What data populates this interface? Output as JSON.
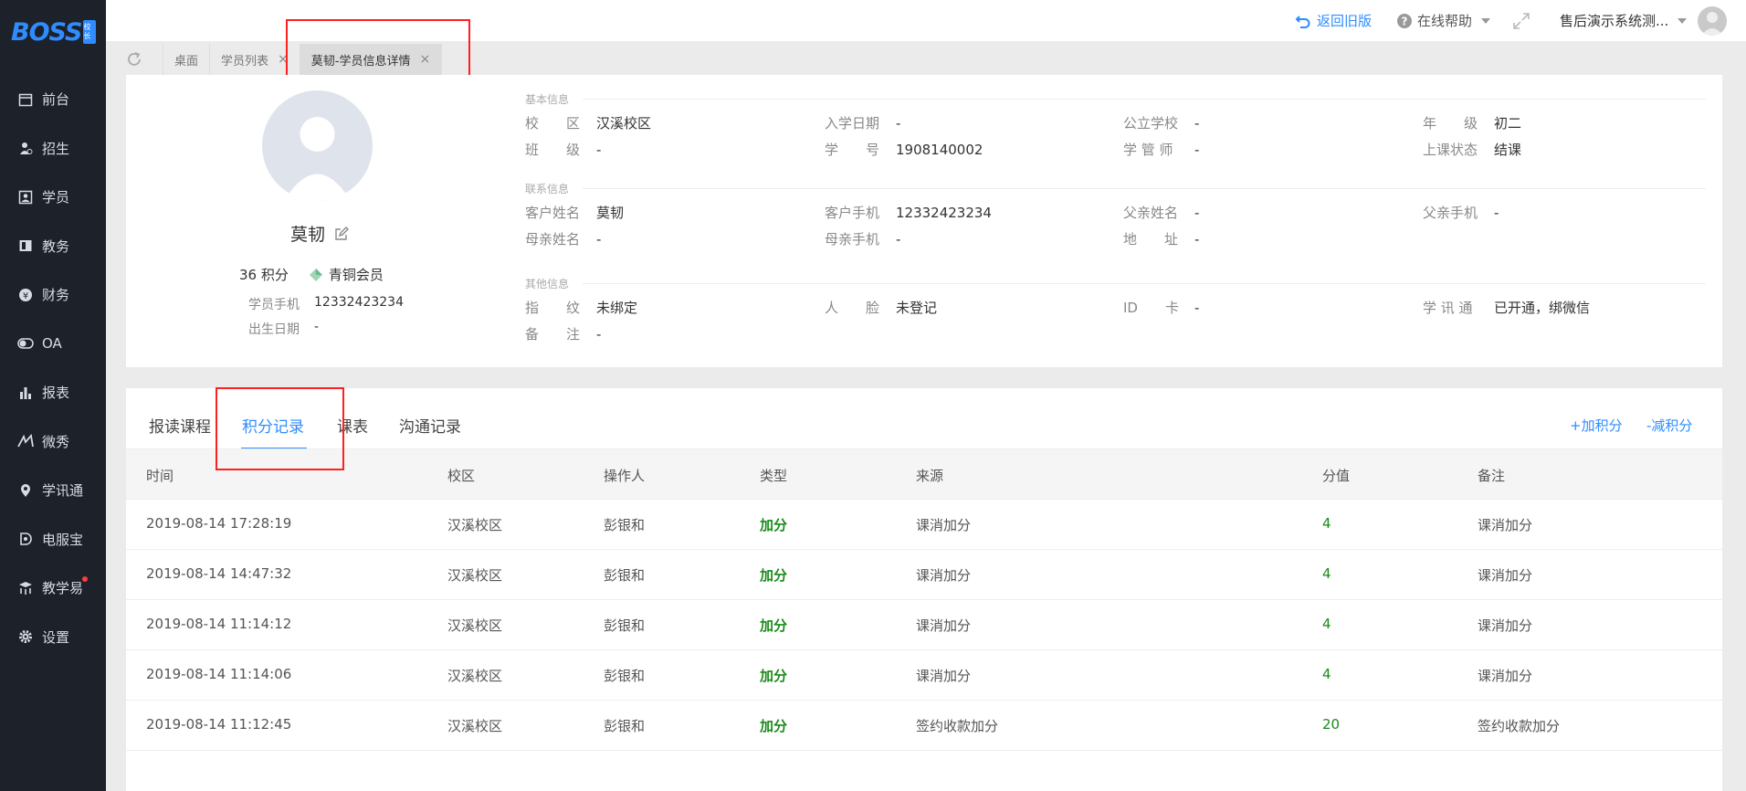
{
  "brand": {
    "logo_text": "BOSS",
    "badge_text": "校长"
  },
  "sidebar": {
    "items": [
      {
        "label": "前台",
        "icon": "calendar-icon"
      },
      {
        "label": "招生",
        "icon": "person-add-icon"
      },
      {
        "label": "学员",
        "icon": "student-card-icon"
      },
      {
        "label": "教务",
        "icon": "book-icon"
      },
      {
        "label": "财务",
        "icon": "yen-icon"
      },
      {
        "label": "OA",
        "icon": "toggle-icon"
      },
      {
        "label": "报表",
        "icon": "bar-chart-icon"
      },
      {
        "label": "微秀",
        "icon": "xiu-icon"
      },
      {
        "label": "学讯通",
        "icon": "location-pin-icon"
      },
      {
        "label": "电服宝",
        "icon": "phone-service-icon"
      },
      {
        "label": "教学易",
        "icon": "teach-icon"
      },
      {
        "label": "设置",
        "icon": "gear-icon"
      }
    ]
  },
  "topbar": {
    "back_old": "返回旧版",
    "help": "在线帮助",
    "account": "售后演示系统测..."
  },
  "tabs": [
    {
      "label": "桌面"
    },
    {
      "label": "学员列表",
      "close": "×"
    },
    {
      "label": "莫韧-学员信息详情",
      "close": "×"
    }
  ],
  "student": {
    "name": "莫韧",
    "points": "36 积分",
    "member_level": "青铜会员",
    "phone_label": "学员手机",
    "phone_value": "12332423234",
    "birth_label": "出生日期",
    "birth_value": "-"
  },
  "sections": {
    "basic": "基本信息",
    "contact": "联系信息",
    "other": "其他信息"
  },
  "basic": {
    "campus_l": "校　　区",
    "campus_v": "汉溪校区",
    "enroll_l": "入学日期",
    "enroll_v": "-",
    "school_l": "公立学校",
    "school_v": "-",
    "grade_l": "年　　级",
    "grade_v": "初二",
    "class_l": "班　　级",
    "class_v": "-",
    "sno_l": "学　　号",
    "sno_v": "1908140002",
    "mgr_l": "学 管 师",
    "mgr_v": "-",
    "status_l": "上课状态",
    "status_v": "结课"
  },
  "contact": {
    "cname_l": "客户姓名",
    "cname_v": "莫韧",
    "cphone_l": "客户手机",
    "cphone_v": "12332423234",
    "fname_l": "父亲姓名",
    "fname_v": "-",
    "fphone_l": "父亲手机",
    "fphone_v": "-",
    "mname_l": "母亲姓名",
    "mname_v": "-",
    "mphone_l": "母亲手机",
    "mphone_v": "-",
    "addr_l": "地　　址",
    "addr_v": "-"
  },
  "other": {
    "finger_l": "指　　纹",
    "finger_v": "未绑定",
    "face_l": "人　　脸",
    "face_v": "未登记",
    "idcard_l": "ID　　卡",
    "idcard_v": "-",
    "xxt_l": "学 讯 通",
    "xxt_opened": "已开通",
    "xxt_sep": "，",
    "xxt_bind": "绑微信",
    "remark_l": "备　　注",
    "remark_v": "-"
  },
  "records": {
    "tabs": [
      "报读课程",
      "积分记录",
      "课表",
      "沟通记录"
    ],
    "add_points": "+加积分",
    "sub_points": "-减积分",
    "columns": [
      "时间",
      "校区",
      "操作人",
      "类型",
      "来源",
      "分值",
      "备注"
    ],
    "rows": [
      [
        "2019-08-14 17:28:19",
        "汉溪校区",
        "彭银和",
        "加分",
        "课消加分",
        "4",
        "课消加分"
      ],
      [
        "2019-08-14 14:47:32",
        "汉溪校区",
        "彭银和",
        "加分",
        "课消加分",
        "4",
        "课消加分"
      ],
      [
        "2019-08-14 11:14:12",
        "汉溪校区",
        "彭银和",
        "加分",
        "课消加分",
        "4",
        "课消加分"
      ],
      [
        "2019-08-14 11:14:06",
        "汉溪校区",
        "彭银和",
        "加分",
        "课消加分",
        "4",
        "课消加分"
      ],
      [
        "2019-08-14 11:12:45",
        "汉溪校区",
        "彭银和",
        "加分",
        "签约收款加分",
        "20",
        "签约收款加分"
      ]
    ]
  }
}
